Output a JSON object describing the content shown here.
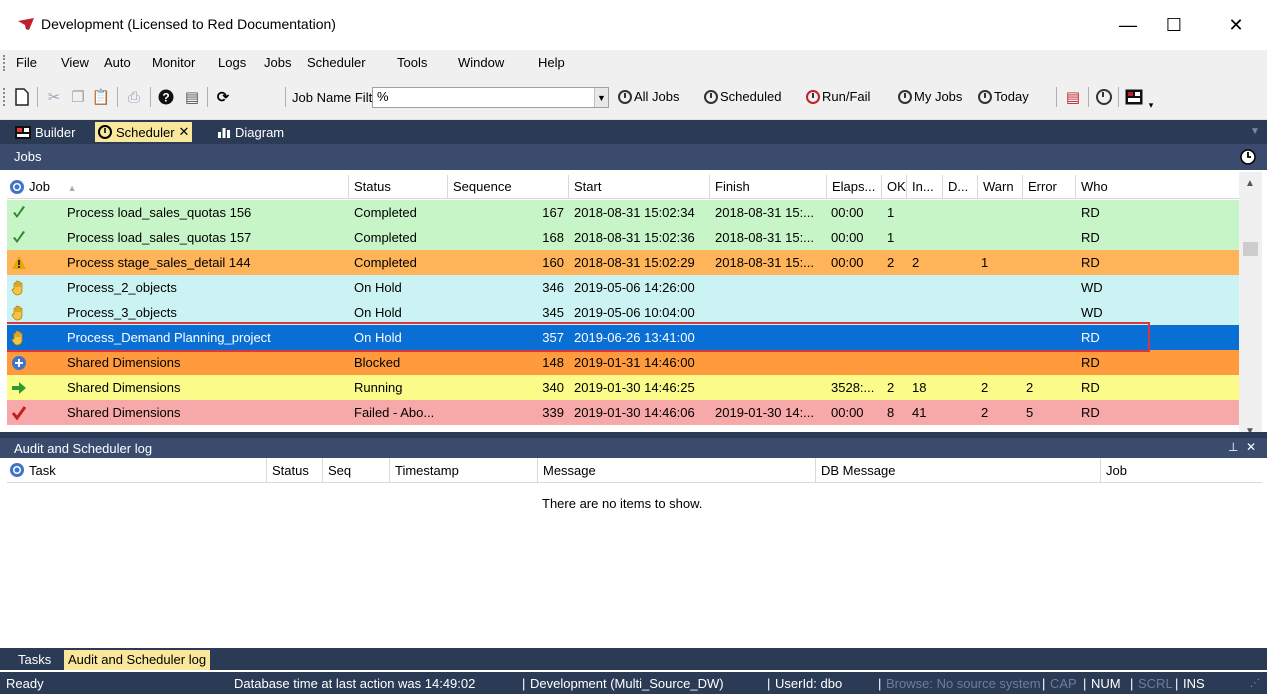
{
  "window": {
    "title": "Development  (Licensed to Red Documentation)",
    "minimize": "—",
    "maximize": "☐",
    "close": "✕"
  },
  "menu": [
    "File",
    "View",
    "Auto",
    "Monitor",
    "Logs",
    "Jobs",
    "Scheduler",
    "Tools",
    "Window",
    "Help"
  ],
  "toolbar": {
    "job_name_filter_label": "Job Name Filter:",
    "job_name_filter_value": "%",
    "all_jobs": "All Jobs",
    "scheduled": "Scheduled",
    "run_fail": "Run/Fail",
    "my_jobs": "My Jobs",
    "today": "Today"
  },
  "doc_tabs": {
    "builder": "Builder",
    "scheduler": "Scheduler",
    "scheduler_close": "✕",
    "diagram": "Diagram"
  },
  "jobs_panel": {
    "title": "Jobs",
    "columns": [
      "Job",
      "Status",
      "Sequence",
      "Start",
      "Finish",
      "Elaps...",
      "OK",
      "In...",
      "D...",
      "Warn",
      "Error",
      "Who"
    ],
    "rows": [
      {
        "icon": "check-icon",
        "job": "Process load_sales_quotas 156",
        "status": "Completed",
        "sequence": "167",
        "start": "2018-08-31 15:02:34",
        "finish": "2018-08-31 15:...",
        "elapsed": "00:00",
        "ok": "1",
        "info": "",
        "detail": "",
        "warn": "",
        "error": "",
        "who": "RD",
        "bg": "#c8f5c8",
        "color": "#000000"
      },
      {
        "icon": "check-icon",
        "job": "Process load_sales_quotas 157",
        "status": "Completed",
        "sequence": "168",
        "start": "2018-08-31 15:02:36",
        "finish": "2018-08-31 15:...",
        "elapsed": "00:00",
        "ok": "1",
        "info": "",
        "detail": "",
        "warn": "",
        "error": "",
        "who": "RD",
        "bg": "#c8f5c8",
        "color": "#000000"
      },
      {
        "icon": "warning-icon",
        "job": "Process stage_sales_detail 144",
        "status": "Completed",
        "sequence": "160",
        "start": "2018-08-31 15:02:29",
        "finish": "2018-08-31 15:...",
        "elapsed": "00:00",
        "ok": "2",
        "info": "2",
        "detail": "",
        "warn": "1",
        "error": "",
        "who": "RD",
        "bg": "#ffb45a",
        "color": "#000000"
      },
      {
        "icon": "hand-icon",
        "job": "Process_2_objects",
        "status": "On Hold",
        "sequence": "346",
        "start": "2019-05-06 14:26:00",
        "finish": "",
        "elapsed": "",
        "ok": "",
        "info": "",
        "detail": "",
        "warn": "",
        "error": "",
        "who": "WD",
        "bg": "#ccf3f3",
        "color": "#000000"
      },
      {
        "icon": "hand-icon",
        "job": "Process_3_objects",
        "status": "On Hold",
        "sequence": "345",
        "start": "2019-05-06 10:04:00",
        "finish": "",
        "elapsed": "",
        "ok": "",
        "info": "",
        "detail": "",
        "warn": "",
        "error": "",
        "who": "WD",
        "bg": "#ccf3f3",
        "color": "#000000"
      },
      {
        "icon": "hand-icon",
        "job": "Process_Demand Planning_project",
        "status": "On Hold",
        "sequence": "357",
        "start": "2019-06-26 13:41:00",
        "finish": "",
        "elapsed": "",
        "ok": "",
        "info": "",
        "detail": "",
        "warn": "",
        "error": "",
        "who": "RD",
        "bg": "#0a6fd4",
        "color": "#ffffff"
      },
      {
        "icon": "blocked-icon",
        "job": "Shared Dimensions",
        "status": "Blocked",
        "sequence": "148",
        "start": "2019-01-31 14:46:00",
        "finish": "",
        "elapsed": "",
        "ok": "",
        "info": "",
        "detail": "",
        "warn": "",
        "error": "",
        "who": "RD",
        "bg": "#ff9b3c",
        "color": "#000000"
      },
      {
        "icon": "run-arrow-icon",
        "job": "Shared Dimensions",
        "status": "Running",
        "sequence": "340",
        "start": "2019-01-30 14:46:25",
        "finish": "",
        "elapsed": "3528:...",
        "ok": "2",
        "info": "18",
        "detail": "",
        "warn": "2",
        "error": "2",
        "who": "RD",
        "bg": "#fbfb8a",
        "color": "#000000"
      },
      {
        "icon": "fail-icon",
        "job": "Shared Dimensions",
        "status": "Failed - Abo...",
        "sequence": "339",
        "start": "2019-01-30 14:46:06",
        "finish": "2019-01-30 14:...",
        "elapsed": "00:00",
        "ok": "8",
        "info": "41",
        "detail": "",
        "warn": "2",
        "error": "5",
        "who": "RD",
        "bg": "#f7a8a8",
        "color": "#000000"
      }
    ]
  },
  "audit_panel": {
    "title": "Audit and Scheduler log",
    "pin": "⊥",
    "close": "✕",
    "columns": [
      "Task",
      "Status",
      "Seq",
      "Timestamp",
      "Message",
      "DB Message",
      "Job"
    ],
    "empty_text": "There are no items to show."
  },
  "bottom_tabs": {
    "tasks": "Tasks",
    "audit": "Audit and Scheduler log"
  },
  "status_bar": {
    "ready": "Ready",
    "db_time": "Database time at last action was 14:49:02",
    "connection": "Development (Multi_Source_DW)",
    "user": "UserId: dbo",
    "browse": "Browse: No source system",
    "cap": "CAP",
    "num": "NUM",
    "scrl": "SCRL",
    "ins": "INS"
  },
  "colors": {
    "dock_bg": "#2b3a55",
    "panel_header": "#3a4b6e",
    "active_tab": "#f9e79b",
    "selected_row_outline": "#d9363e"
  }
}
